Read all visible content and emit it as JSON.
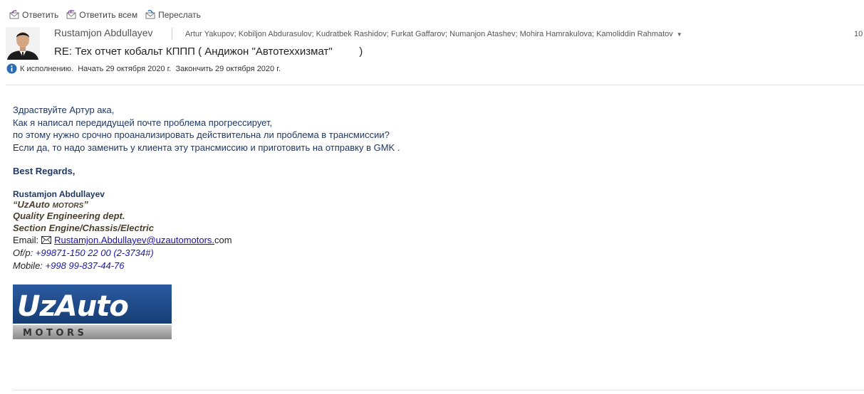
{
  "toolbar": {
    "reply_label": "Ответить",
    "reply_all_label": "Ответить всем",
    "forward_label": "Переслать"
  },
  "header": {
    "sender": "Rustamjon Abdullayev",
    "recipients": "Artur Yakupov; Kobiljon Abdurasulov; Kudratbek Rashidov; Furkat Gaffarov; Numanjon Atashev; Mohira Hamrakulova; Kamoliddin Rahmatov",
    "date_partial": "10",
    "subject": "RE: Тех отчет кобальт КППП ( Андижон \"Автотеххизмат\"         )",
    "flag_text": "К исполнению.  Начать 29 октября 2020 г.  Закончить 29 октября 2020 г."
  },
  "body": {
    "lines": [
      "Здраствуйте Артур ака,",
      "Как я написал передидущей почте проблема прогрессирует,",
      "по этому нужно срочно проанализировать действительна ли проблема в трансмиссии?",
      "Если да, то надо заменить у клиента эту трансмиссию и приготовить на отправку в GMK ."
    ],
    "regards": "Best Regards,"
  },
  "signature": {
    "name": "Rustamjon Abdullayev",
    "company_main": "“UzAuto ",
    "company_small": "MOTORS",
    "company_end": "”",
    "dept": "Quality Engineering dept.",
    "section": "Section Engine/Chassis/Electric",
    "email_label": "Email:",
    "email_link": "Rustamjon.Abdullayev@uzautomotors.",
    "email_tail": "com",
    "offp_label": "Of/p: ",
    "offp_value": "+99871-150 22 00 (2-3734#)",
    "mobile_label": "Mobile: ",
    "mobile_value": "+998 99-837-44-76"
  },
  "logo": {
    "main": "UzAuto",
    "sub": "M O T O R S",
    "bg_color": "#1f4e8c"
  },
  "colors": {
    "body_text": "#1f3864",
    "link": "#1a0dab"
  }
}
